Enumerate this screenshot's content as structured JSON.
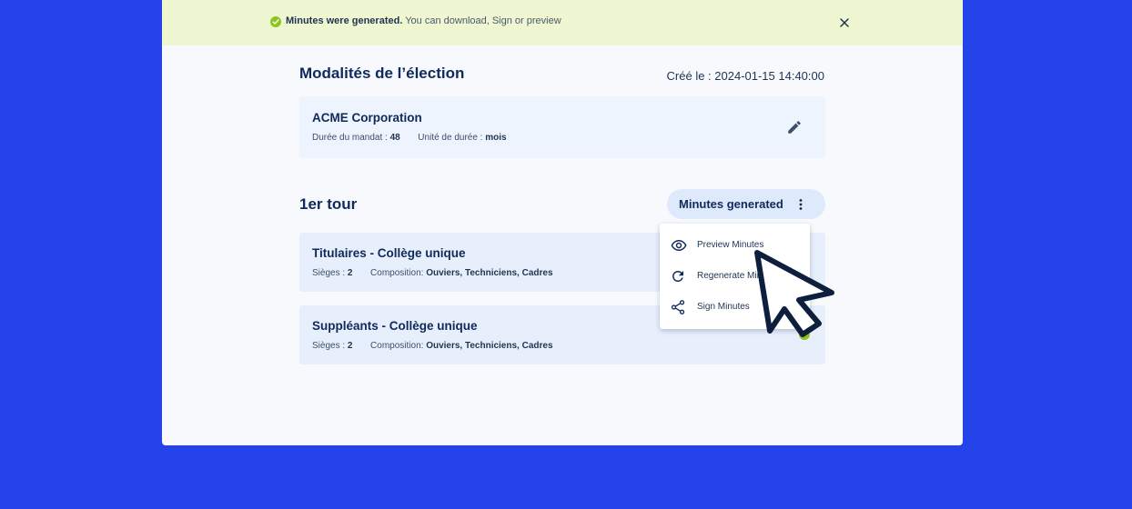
{
  "banner": {
    "bold": "Minutes were generated.",
    "text": " You can download, Sign or preview",
    "icon": "check-circle-icon",
    "close_icon": "close-icon"
  },
  "page": {
    "title": "Modalités de l’élection",
    "created": "Créé le : 2024-01-15 14:40:00"
  },
  "company": {
    "name": "ACME Corporation",
    "mandate_label": "Durée du mandat :",
    "mandate_value": "48",
    "unit_label": "Unité de durée :",
    "unit_value": "mois",
    "edit_icon": "pencil-icon"
  },
  "round": {
    "title": "1er tour",
    "status_label": "Minutes generated",
    "more_icon": "kebab-menu-icon"
  },
  "colleges": [
    {
      "title": "Titulaires - Collège unique",
      "seats_label": "Sièges :",
      "seats_value": "2",
      "composition_label": "Composition:",
      "composition_value": "Ouviers, Techniciens, Cadres"
    },
    {
      "title": "Suppléants - Collège unique",
      "seats_label": "Sièges :",
      "seats_value": "2",
      "composition_label": "Composition:",
      "composition_value": "Ouviers, Techniciens, Cadres"
    }
  ],
  "menu": {
    "items": [
      {
        "label": "Preview Minutes",
        "icon": "eye-icon"
      },
      {
        "label": "Regenerate Minutes",
        "icon": "refresh-icon"
      },
      {
        "label": "Sign Minutes",
        "icon": "share-icon"
      }
    ]
  },
  "colors": {
    "background": "#2443e8",
    "banner": "#eef6d2",
    "success": "#8fc31f",
    "text": "#0f2a5a"
  }
}
